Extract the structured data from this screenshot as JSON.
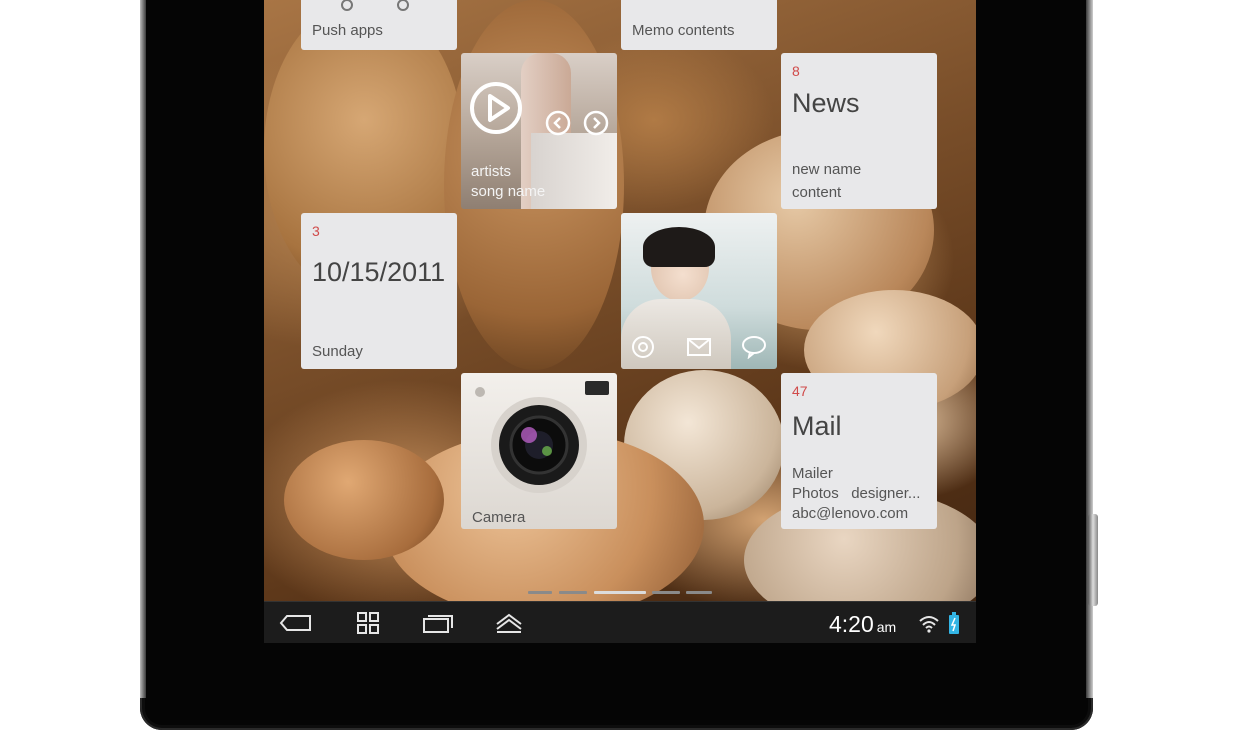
{
  "tiles": {
    "push_apps": {
      "label": "Push apps"
    },
    "memo": {
      "label": "Memo contents"
    },
    "music": {
      "artist": "artists",
      "song": "song name"
    },
    "news": {
      "count": "8",
      "title": "News",
      "line1": "new name",
      "line2": "content"
    },
    "calendar": {
      "count": "3",
      "date": "10/15/2011",
      "day": "Sunday"
    },
    "contact": {},
    "camera": {
      "label": "Camera"
    },
    "mail": {
      "count": "47",
      "title": "Mail",
      "line1": "Mailer",
      "line2": "Photos   designer...",
      "line3": "abc@lenovo.com"
    }
  },
  "status_bar": {
    "time": "4:20",
    "ampm": "am"
  },
  "colors": {
    "accent_count": "#d04a4a",
    "tile_bg": "#e8e8ea",
    "nav_bg": "#1c1c1c"
  },
  "icons": [
    "back-icon",
    "apps-grid-icon",
    "recent-apps-icon",
    "menu-up-icon",
    "wifi-icon",
    "battery-icon",
    "play-icon",
    "prev-icon",
    "next-icon",
    "at-icon",
    "email-icon",
    "chat-icon"
  ]
}
